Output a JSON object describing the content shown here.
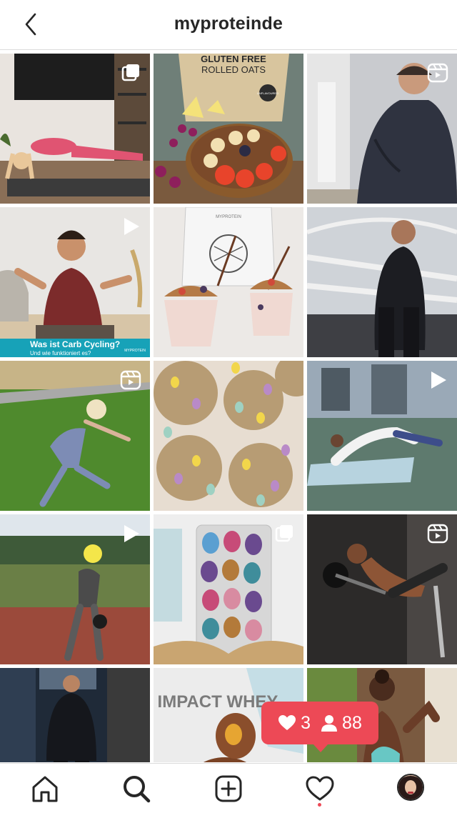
{
  "header": {
    "title": "myproteinde",
    "back_icon": "chevron-left-icon"
  },
  "grid": {
    "posts": [
      {
        "id": "post-1",
        "badge": "multiple-photos-icon"
      },
      {
        "id": "post-2",
        "badge": "",
        "bag_text_1": "GLUTEN FREE",
        "bag_text_2": "ROLLED OATS",
        "bag_sticker": "UNFLAVOURED"
      },
      {
        "id": "post-3",
        "badge": "reels-icon"
      },
      {
        "id": "post-4",
        "badge": "play-icon",
        "caption": "Was ist Carb Cycling?",
        "caption_sub": "Und wie funktioniert es?",
        "caption_brand": "MYPROTEIN"
      },
      {
        "id": "post-5",
        "badge": "",
        "bag_text": "MYPROTEIN"
      },
      {
        "id": "post-6",
        "badge": ""
      },
      {
        "id": "post-7",
        "badge": "reels-icon"
      },
      {
        "id": "post-8",
        "badge": ""
      },
      {
        "id": "post-9",
        "badge": "play-icon"
      },
      {
        "id": "post-10",
        "badge": "play-icon"
      },
      {
        "id": "post-11",
        "badge": "multiple-photos-icon"
      },
      {
        "id": "post-12",
        "badge": "reels-icon"
      },
      {
        "id": "post-13",
        "badge": ""
      },
      {
        "id": "post-14",
        "badge": "",
        "text": "IMPACT WHEY"
      },
      {
        "id": "post-15",
        "badge": ""
      }
    ]
  },
  "notification": {
    "likes": "3",
    "followers": "88",
    "like_icon": "heart-icon",
    "follower_icon": "person-icon"
  },
  "bottom_nav": {
    "items": [
      "home-icon",
      "search-icon",
      "add-post-icon",
      "activity-heart-icon",
      "profile-avatar"
    ],
    "active": "search-icon"
  },
  "colors": {
    "notification": "#ed4956",
    "text": "#262626",
    "border": "#dbdbdb"
  }
}
